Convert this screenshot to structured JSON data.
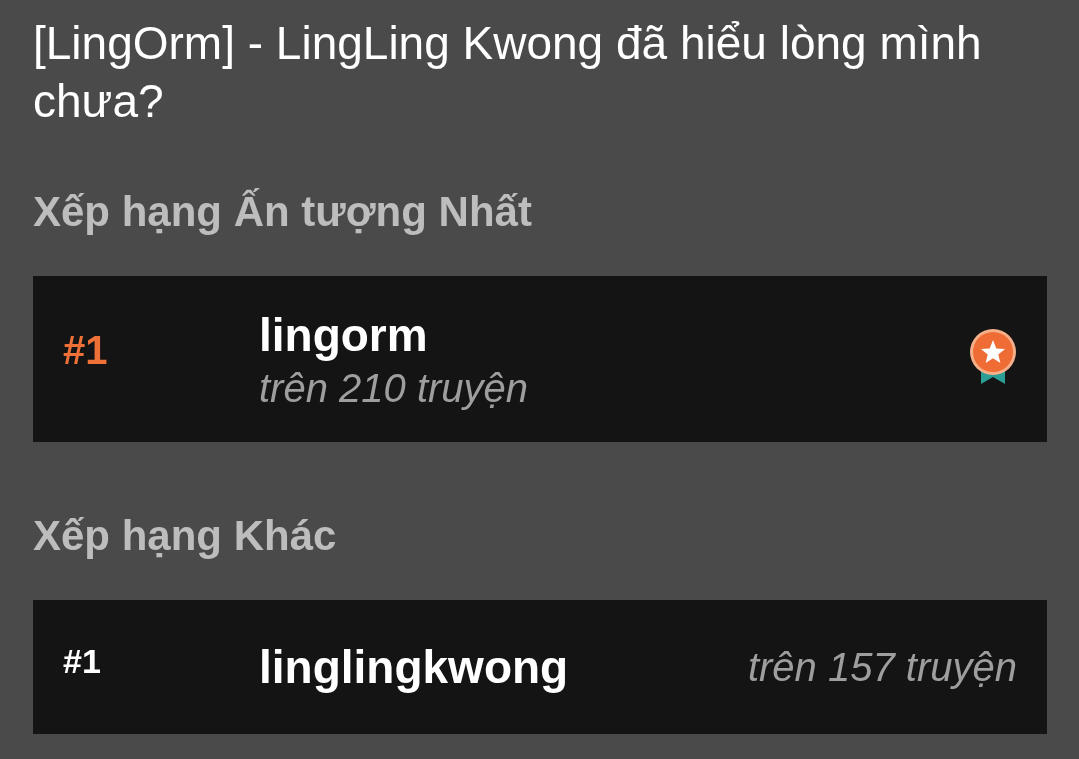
{
  "title": "[LingOrm] - LingLing Kwong đã hiểu lòng mình chưa?",
  "sections": [
    {
      "heading": "Xếp hạng Ấn tượng Nhất",
      "rankings": [
        {
          "kind": "featured",
          "rank": "#1",
          "tag": "lingorm",
          "count": "trên 210 truyện"
        }
      ]
    },
    {
      "heading": "Xếp hạng Khác",
      "rankings": [
        {
          "kind": "plain",
          "rank": "#1",
          "tag": "linglingkwong",
          "count": "trên 157 truyện"
        }
      ]
    }
  ]
}
